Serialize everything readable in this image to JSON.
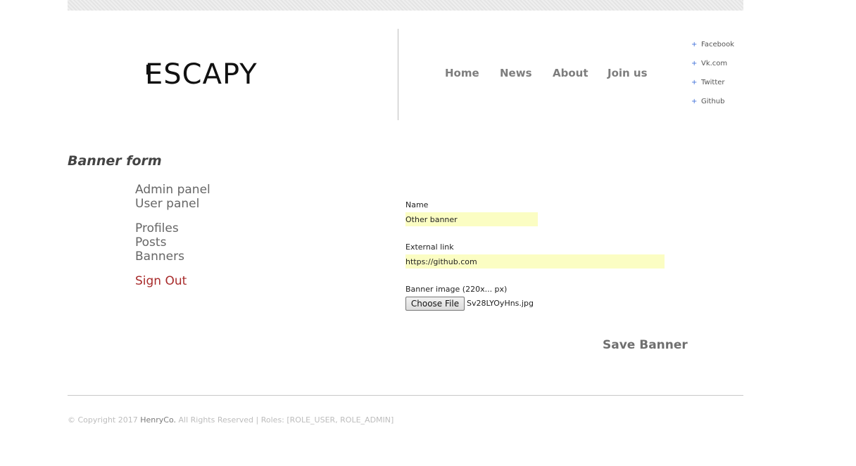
{
  "header": {
    "logo_text": "ESCAPY",
    "nav": [
      "Home",
      "News",
      "About",
      "Join us"
    ],
    "social": [
      "Facebook",
      "Vk.com",
      "Twitter",
      "Github"
    ],
    "social_bullet": "+"
  },
  "page": {
    "title": "Banner form"
  },
  "sidebar": {
    "panels": [
      "Admin panel",
      "User panel"
    ],
    "sections": [
      "Profiles",
      "Posts",
      "Banners"
    ],
    "sign_out": "Sign Out"
  },
  "form": {
    "name_label": "Name",
    "name_value": "Other banner",
    "link_label": "External link",
    "link_value": "https://github.com",
    "image_label": "Banner image (220x... px)",
    "file_button": "Choose File",
    "file_name": "Sv28LYOyHns.jpg",
    "save_label": "Save Banner"
  },
  "footer": {
    "copyright": "© Copyright 2017",
    "brand": "HenryCo.",
    "rest": "All Rights Reserved | Roles: [ROLE_USER, ROLE_ADMIN]"
  },
  "colors": {
    "input_bg": "#fbfdc3",
    "sign_out": "#a82b2b",
    "bullet": "#3f6fd8"
  }
}
